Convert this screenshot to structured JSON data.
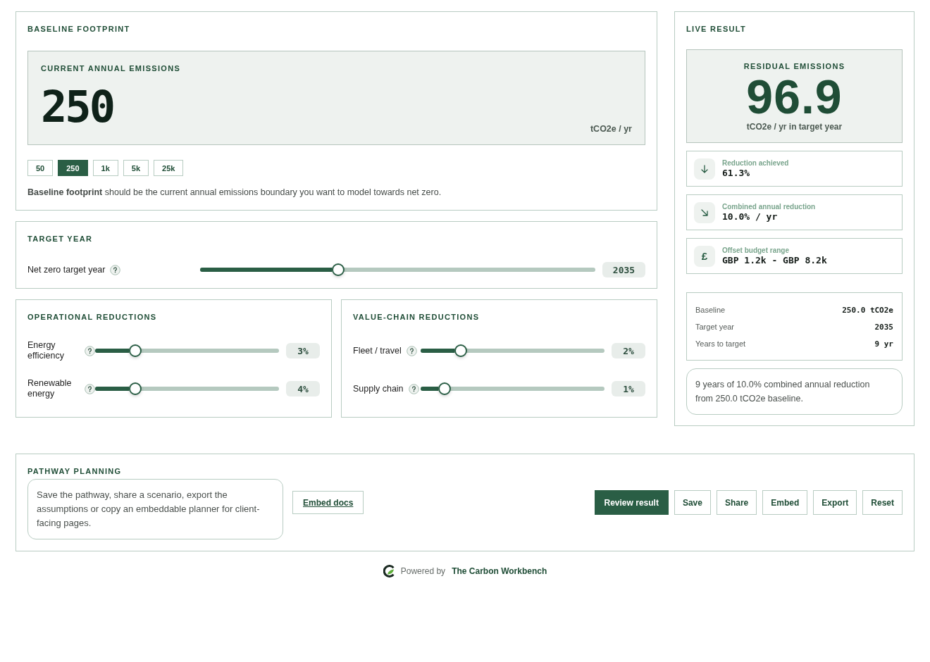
{
  "baseline": {
    "title": "BASELINE FOOTPRINT",
    "current": {
      "label": "CURRENT ANNUAL EMISSIONS",
      "value": "250",
      "unit": "tCO2e / yr"
    },
    "presets": [
      {
        "label": "50",
        "selected": false
      },
      {
        "label": "250",
        "selected": true
      },
      {
        "label": "1k",
        "selected": false
      },
      {
        "label": "5k",
        "selected": false
      },
      {
        "label": "25k",
        "selected": false
      }
    ],
    "help": "**Baseline footprint** should be the current annual emissions boundary you want to model towards net zero."
  },
  "target_year": {
    "title": "TARGET YEAR",
    "label": "Net zero target year",
    "level": 0.35,
    "value": "2035"
  },
  "reduction_groups": [
    {
      "title": "OPERATIONAL REDUCTIONS",
      "sliders": [
        {
          "label": "Energy efficiency",
          "level": 0.22,
          "value": "3%"
        },
        {
          "label": "Renewable energy",
          "level": 0.22,
          "value": "4%"
        }
      ]
    },
    {
      "title": "VALUE-CHAIN REDUCTIONS",
      "sliders": [
        {
          "label": "Fleet / travel",
          "level": 0.22,
          "value": "2%"
        },
        {
          "label": "Supply chain",
          "level": 0.13,
          "value": "1%"
        }
      ]
    }
  ],
  "live_result": {
    "title": "LIVE RESULT",
    "residual": {
      "label": "RESIDUAL EMISSIONS",
      "value": "96.9",
      "unit": "tCO2e / yr in target year"
    },
    "metrics": [
      {
        "kind": "arrow-down",
        "label": "Reduction achieved",
        "value": "61.3%"
      },
      {
        "kind": "arrow-down-right",
        "label": "Combined annual reduction",
        "value": "10.0% / yr"
      },
      {
        "kind": "symbol",
        "symbol": "£",
        "label": "Offset budget range",
        "value": "GBP 1.2k - GBP 8.2k"
      }
    ],
    "summary": [
      {
        "label": "Baseline",
        "value": "250.0 tCO2e"
      },
      {
        "label": "Target year",
        "value": "2035"
      },
      {
        "label": "Years to target",
        "value": "9 yr"
      }
    ],
    "note": "9 years of 10.0% combined annual reduction from 250.0 tCO2e baseline."
  },
  "pathway": {
    "title": "PATHWAY PLANNING",
    "description": "Save the pathway, share a scenario, export the assumptions or copy an embeddable planner for client-facing pages.",
    "docs_link": "Embed docs",
    "buttons": [
      {
        "label": "Review result",
        "primary": true
      },
      {
        "label": "Save",
        "primary": false
      },
      {
        "label": "Share",
        "primary": false
      },
      {
        "label": "Embed",
        "primary": false
      },
      {
        "label": "Export",
        "primary": false
      },
      {
        "label": "Reset",
        "primary": false
      }
    ]
  },
  "footer": {
    "prefix": "Powered by",
    "brand": "The Carbon Workbench"
  }
}
